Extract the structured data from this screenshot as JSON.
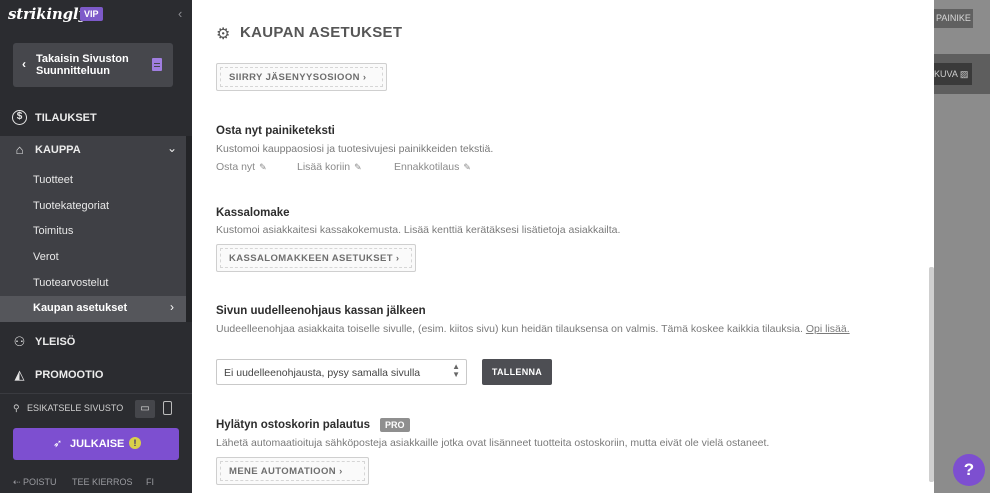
{
  "sidebar": {
    "brand": "strikingly",
    "badge": "VIP",
    "back_label": "Takaisin Sivuston Suunnitteluun",
    "nav": [
      {
        "label": "TILAUKSET",
        "icon": "dollar-icon"
      },
      {
        "label": "KAUPPA",
        "icon": "store-icon"
      },
      {
        "label": "YLEISÖ",
        "icon": "users-icon"
      },
      {
        "label": "PROMOOTIO",
        "icon": "megaphone-icon"
      }
    ],
    "shop_items": [
      "Tuotteet",
      "Tuotekategoriat",
      "Toimitus",
      "Verot",
      "Tuotearvostelut",
      "Kaupan asetukset"
    ],
    "preview_label": "ESIKATSELE SIVUSTO",
    "publish_label": "JULKAISE",
    "footer": {
      "exit": "POISTU",
      "tour": "TEE KIERROS",
      "lang": "FI"
    }
  },
  "main": {
    "title": "KAUPAN ASETUKSET",
    "membership_button": "SIIRRY JÄSENYYSOSIOON ›",
    "buy_text": {
      "title": "Osta nyt painiketeksti",
      "desc": "Kustomoi kauppaosiosi ja tuotesivujesi painikkeiden tekstiä.",
      "options": [
        "Osta nyt",
        "Lisää koriin",
        "Ennakkotilaus"
      ]
    },
    "checkout": {
      "title": "Kassalomake",
      "desc": "Kustomoi asiakkaitesi kassakokemusta. Lisää kenttiä kerätäksesi lisätietoja asiakkailta.",
      "button": "KASSALOMAKKEEN ASETUKSET ›"
    },
    "redirect": {
      "title": "Sivun uudelleenohjaus kassan jälkeen",
      "desc": "Uudeelleenohjaa asiakkaita toiselle sivulle, (esim. kiitos sivu) kun heidän tilauksensa on valmis. Tämä koskee kaikkia tilauksia.",
      "link": "Opi lisää.",
      "selected": "Ei uudelleenohjausta, pysy samalla sivulla",
      "save": "TALLENNA"
    },
    "abandoned": {
      "title": "Hylätyn ostoskorin palautus",
      "badge": "PRO",
      "desc": "Lähetä automaatioituja sähköposteja asiakkaille jotka ovat lisänneet tuotteita ostoskoriin, mutta eivät ole vielä ostaneet.",
      "button": "MENE AUTOMATIOON ›"
    }
  },
  "backdrop": {
    "btn1": "PAINIKE",
    "btn2": "KUVA"
  },
  "help": {
    "label": "?"
  },
  "colors": {
    "accent": "#7d4fd0",
    "sidebar": "#2b2c30",
    "vip": "#7d5ac9"
  }
}
